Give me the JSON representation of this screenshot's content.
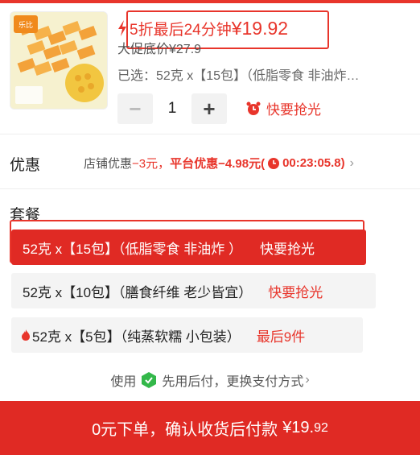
{
  "product": {
    "image_alt": "nut snack package",
    "image_label": "Brand logo",
    "flash_text": "5折最后24分钟",
    "flash_price": "¥19.92",
    "promo_price": "大促底价¥27.9",
    "selected": "已选：52克 x【15包】（低脂零食 非油炸…",
    "quantity": "1",
    "rush_label": "快要抢光"
  },
  "coupon": {
    "title": "优惠",
    "store_label": "店铺优惠",
    "store_amount": "−3元，",
    "platform_label": "平台优惠",
    "platform_amount": "−4.98元(",
    "timer": "00:23:05.8)"
  },
  "package": {
    "title": "套餐",
    "options": [
      {
        "label": "52克 x【15包】（低脂零食 非油炸 ）",
        "tag": "快要抢光"
      },
      {
        "label": "52克 x【10包】（膳食纤维 老少皆宜）",
        "tag": "快要抢光"
      },
      {
        "label": "52克 x【5包】（纯蒸软糯 小包装）",
        "tag": "最后9件"
      }
    ]
  },
  "pay_later": {
    "prefix": "使用",
    "text": "先用后付，更换支付方式"
  },
  "checkout": {
    "label": "0元下单，确认收货后付款",
    "price_int": "¥19.",
    "price_dec": "92"
  },
  "colors": {
    "accent": "#e8352b",
    "button": "#e02a24"
  }
}
